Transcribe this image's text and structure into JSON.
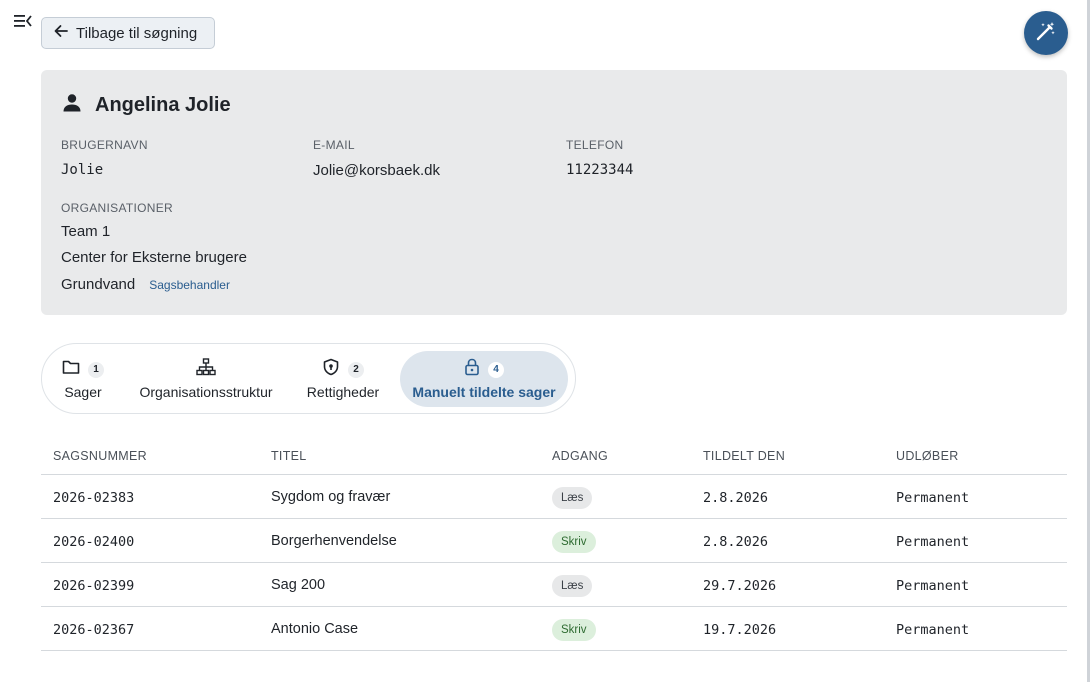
{
  "toolbar": {
    "back_label": "Tilbage til søgning"
  },
  "profile": {
    "name": "Angelina Jolie",
    "username_label": "BRUGERNAVN",
    "username": "Jolie",
    "email_label": "E-MAIL",
    "email": "Jolie@korsbaek.dk",
    "phone_label": "TELEFON",
    "phone": "11223344",
    "organizations_label": "ORGANISATIONER",
    "organizations": [
      {
        "name": "Team 1",
        "role": ""
      },
      {
        "name": "Center for Eksterne brugere",
        "role": ""
      },
      {
        "name": "Grundvand",
        "role": "Sagsbehandler"
      }
    ]
  },
  "tabs": [
    {
      "label": "Sager",
      "count": "1",
      "icon": "folder-icon",
      "active": false
    },
    {
      "label": "Organisationsstruktur",
      "count": "",
      "icon": "org-chart-icon",
      "active": false
    },
    {
      "label": "Rettigheder",
      "count": "2",
      "icon": "shield-icon",
      "active": false
    },
    {
      "label": "Manuelt tildelte sager",
      "count": "4",
      "icon": "lock-icon",
      "active": true
    }
  ],
  "table": {
    "headers": {
      "case_number": "SAGSNUMMER",
      "title": "TITEL",
      "access": "ADGANG",
      "assigned": "TILDELT DEN",
      "expires": "UDLØBER"
    },
    "rows": [
      {
        "case_number": "2026-02383",
        "title": "Sygdom og fravær",
        "access": "Læs",
        "access_type": "read",
        "assigned": "2.8.2026",
        "expires": "Permanent"
      },
      {
        "case_number": "2026-02400",
        "title": "Borgerhenvendelse",
        "access": "Skriv",
        "access_type": "write",
        "assigned": "2.8.2026",
        "expires": "Permanent"
      },
      {
        "case_number": "2026-02399",
        "title": "Sag 200",
        "access": "Læs",
        "access_type": "read",
        "assigned": "29.7.2026",
        "expires": "Permanent"
      },
      {
        "case_number": "2026-02367",
        "title": "Antonio Case",
        "access": "Skriv",
        "access_type": "write",
        "assigned": "19.7.2026",
        "expires": "Permanent"
      }
    ]
  },
  "colors": {
    "accent": "#2a5d8f",
    "card_bg": "#e9eaeb",
    "badge_read": "#e7e8e9",
    "badge_write": "#dcefdc"
  }
}
